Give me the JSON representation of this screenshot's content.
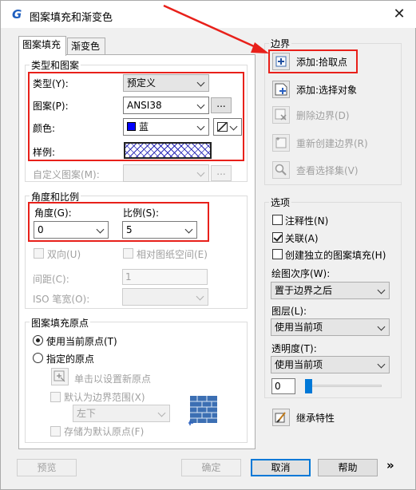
{
  "window": {
    "title": "图案填充和渐变色",
    "close_glyph": "✕",
    "app_glyph": "G"
  },
  "tabs": [
    {
      "label": "图案填充",
      "active": true
    },
    {
      "label": "渐变色",
      "active": false
    }
  ],
  "type_pattern": {
    "group_label": "类型和图案",
    "type_label": "类型(Y):",
    "type_value": "预定义",
    "pattern_label": "图案(P):",
    "pattern_value": "ANSI38",
    "pattern_browse": "...",
    "color_label": "颜色:",
    "color_value": "蓝",
    "color_swatch": "#0000ff",
    "sample_label": "样例:",
    "custom_label": "自定义图案(M):",
    "custom_browse": "..."
  },
  "angle_scale": {
    "group_label": "角度和比例",
    "angle_label": "角度(G):",
    "angle_value": "0",
    "scale_label": "比例(S):",
    "scale_value": "5",
    "double_label": "双向(U)",
    "relative_label": "相对图纸空间(E)",
    "spacing_label": "间距(C):",
    "spacing_value": "1",
    "iso_label": "ISO 笔宽(O):"
  },
  "origin": {
    "group_label": "图案填充原点",
    "use_current": "使用当前原点(T)",
    "specified": "指定的原点",
    "click_set": "单击以设置新原点",
    "default_extent": "默认为边界范围(X)",
    "position_value": "左下",
    "store_default": "存储为默认原点(F)"
  },
  "boundary": {
    "group_label": "边界",
    "add_pick": "添加:拾取点",
    "add_select": "添加:选择对象",
    "remove": "删除边界(D)",
    "recreate": "重新创建边界(R)",
    "view_sel": "查看选择集(V)"
  },
  "options": {
    "group_label": "选项",
    "annotative": "注释性(N)",
    "associative": "关联(A)",
    "separate": "创建独立的图案填充(H)",
    "draw_order_label": "绘图次序(W):",
    "draw_order_value": "置于边界之后",
    "layer_label": "图层(L):",
    "layer_value": "使用当前项",
    "transparency_label": "透明度(T):",
    "transparency_value": "使用当前项",
    "transparency_number": "0"
  },
  "inherit": "继承特性",
  "footer": {
    "preview": "预览",
    "ok": "确定",
    "cancel": "取消",
    "help": "帮助",
    "more": "»"
  },
  "accent": "#e8201a"
}
